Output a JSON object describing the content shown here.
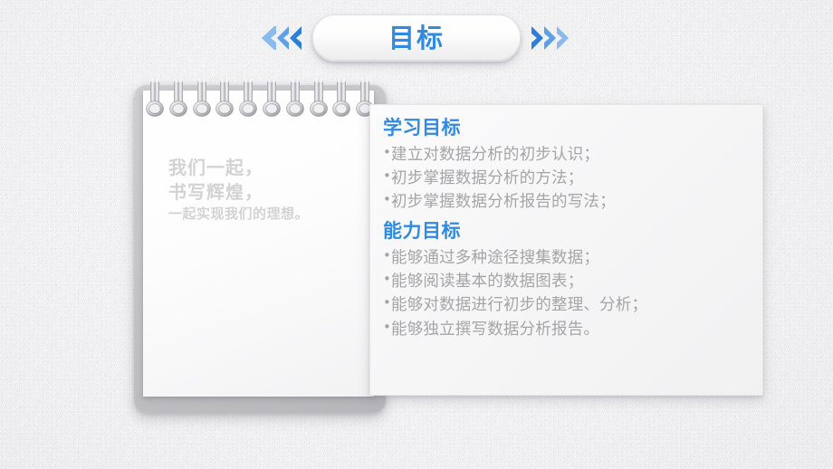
{
  "header": {
    "title": "目标",
    "left_arrows_icon": "double-chevron-left-icon",
    "right_arrows_icon": "double-chevron-right-icon",
    "accent_color": "#2f8ae0"
  },
  "notepad": {
    "watermark": {
      "line1": "我们一起，",
      "line2": "书写辉煌，",
      "line3": "一起实现我们的理想。"
    },
    "ring_count": 10,
    "ring_icon": "spiral-binding-ring-icon"
  },
  "content": {
    "sections": [
      {
        "heading": "学习目标",
        "items": [
          "建立对数据分析的初步认识；",
          "初步掌握数据分析的方法；",
          "初步掌握数据分析报告的写法；"
        ]
      },
      {
        "heading": "能力目标",
        "items": [
          "能够通过多种途径搜集数据；",
          "能够阅读基本的数据图表；",
          "能够对数据进行初步的整理、分析；",
          "能够独立撰写数据分析报告。"
        ]
      }
    ],
    "heading_color": "#2f8ae0",
    "body_color": "#a5a5a7"
  }
}
